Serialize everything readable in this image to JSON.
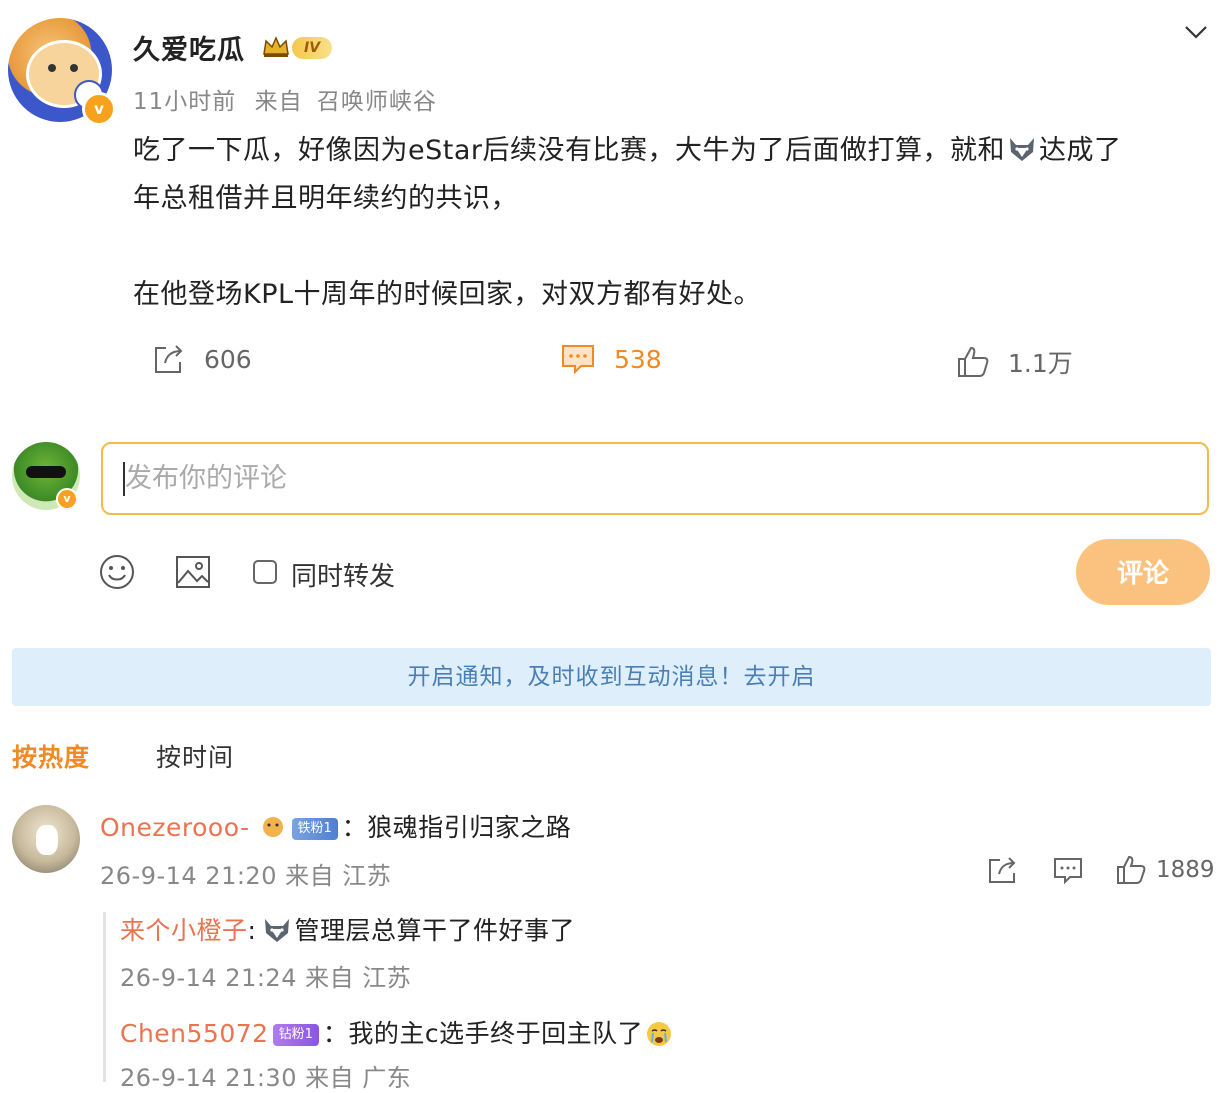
{
  "post": {
    "username": "久爱吃瓜",
    "level_badge": "IV",
    "time": "11小时前",
    "source_prefix": "来自",
    "source": "召唤师峡谷",
    "text_line1_a": "吃了一下瓜，好像因为eStar后续没有比赛，大牛为了后面做打算，就和",
    "text_line1_b": "达成了",
    "text_line2": "年总租借并且明年续约的共识，",
    "text_line3": "在他登场KPL十周年的时候回家，对双方都有好处。",
    "repost_count": "606",
    "comment_count": "538",
    "like_count": "1.1万"
  },
  "composer": {
    "placeholder": "发布你的评论",
    "repost_label": "同时转发",
    "submit_label": "评论"
  },
  "notice": "开启通知，及时收到互动消息！去开启",
  "sort_tabs": {
    "hot": "按热度",
    "time": "按时间"
  },
  "comments": [
    {
      "name": "Onezerooo-",
      "badge": "铁粉1",
      "text": "：狼魂指引归家之路",
      "time": "26-9-14 21:20 来自 江苏",
      "likes": "1889"
    }
  ],
  "replies": [
    {
      "name": "来个小橙子",
      "sep": ":",
      "text": "管理层总算干了件好事了",
      "time": "26-9-14 21:24 来自 江苏"
    },
    {
      "name": "Chen55072",
      "badge": "钻粉1",
      "text": "：我的主c选手终于回主队了",
      "time": "26-9-14 21:30 来自 广东"
    }
  ],
  "colors": {
    "accent": "#f08a24",
    "name": "#eb7350",
    "notice_bg": "#deeefb",
    "notice_text": "#4a7fb5"
  }
}
